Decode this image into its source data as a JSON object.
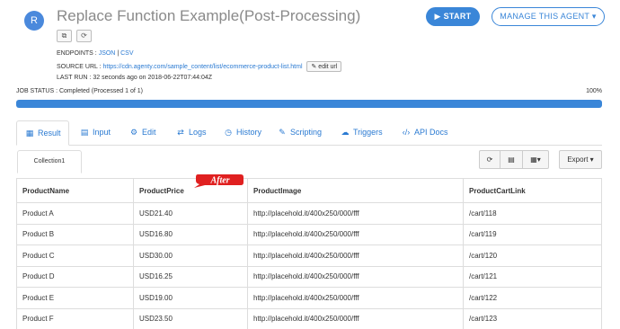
{
  "header": {
    "avatar_letter": "R",
    "title": "Replace Function Example(Post-Processing)",
    "copy_icon": "copy-icon",
    "refresh_icon": "refresh-icon",
    "start_label": "START",
    "manage_label": "MANAGE THIS AGENT"
  },
  "meta": {
    "endpoints_label": "ENDPOINTS :",
    "json_label": "JSON",
    "separator": "|",
    "csv_label": "CSV",
    "source_url_label": "SOURCE URL :",
    "source_url": "https://cdn.agenty.com/sample_content/list/ecommerce-product-list.html",
    "edit_url_label": "edit url",
    "last_run_label": "LAST RUN :",
    "last_run": "32 seconds ago on 2018-06-22T07:44:04Z"
  },
  "job": {
    "status_text": "JOB STATUS : Completed (Processed 1 of 1)",
    "percent_text": "100%",
    "progress_fraction": 1.0
  },
  "tabs": [
    {
      "label": "Result",
      "icon": "table-icon"
    },
    {
      "label": "Input",
      "icon": "input-icon"
    },
    {
      "label": "Edit",
      "icon": "gears-icon"
    },
    {
      "label": "Logs",
      "icon": "logs-icon"
    },
    {
      "label": "History",
      "icon": "history-icon"
    },
    {
      "label": "Scripting",
      "icon": "edit-icon"
    },
    {
      "label": "Triggers",
      "icon": "cloud-upload-icon"
    },
    {
      "label": "API Docs",
      "icon": "code-icon"
    }
  ],
  "result": {
    "collection_tab": "Collection1",
    "export_label": "Export",
    "callout": "After",
    "columns": [
      "ProductName",
      "ProductPrice",
      "ProductImage",
      "ProductCartLink"
    ],
    "rows": [
      [
        "Product A",
        "USD21.40",
        "http://placehold.it/400x250/000/fff",
        "/cart/118"
      ],
      [
        "Product B",
        "USD16.80",
        "http://placehold.it/400x250/000/fff",
        "/cart/119"
      ],
      [
        "Product C",
        "USD30.00",
        "http://placehold.it/400x250/000/fff",
        "/cart/120"
      ],
      [
        "Product D",
        "USD16.25",
        "http://placehold.it/400x250/000/fff",
        "/cart/121"
      ],
      [
        "Product E",
        "USD19.00",
        "http://placehold.it/400x250/000/fff",
        "/cart/122"
      ],
      [
        "Product F",
        "USD23.50",
        "http://placehold.it/400x250/000/fff",
        "/cart/123"
      ]
    ]
  },
  "colors": {
    "accent": "#3a86d8",
    "callout_red": "#e02020"
  }
}
